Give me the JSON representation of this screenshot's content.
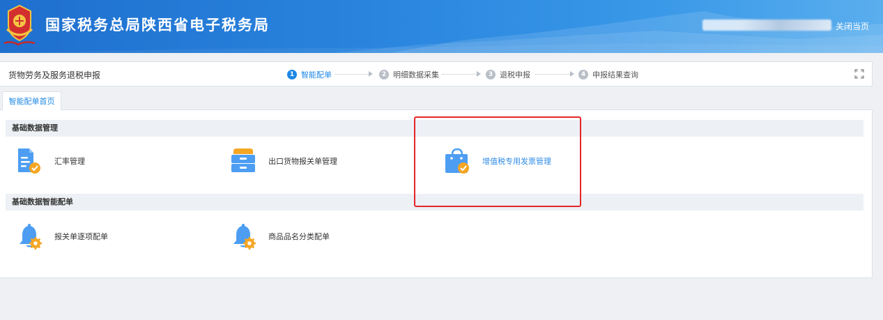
{
  "header": {
    "site_title": "国家税务总局陕西省电子税务局",
    "close_label": "关闭当页",
    "user_info": ""
  },
  "stepbar": {
    "module_title": "货物劳务及服务退税申报",
    "steps": [
      {
        "num": "1",
        "label": "智能配单",
        "active": true
      },
      {
        "num": "2",
        "label": "明细数据采集",
        "active": false
      },
      {
        "num": "3",
        "label": "退税申报",
        "active": false
      },
      {
        "num": "4",
        "label": "申报结果查询",
        "active": false
      }
    ]
  },
  "tab": {
    "label": "智能配单首页"
  },
  "sections": [
    {
      "title": "基础数据管理",
      "items": [
        {
          "label": "汇率管理",
          "icon": "document-check-icon"
        },
        {
          "label": "出口货物报关单管理",
          "icon": "drawer-cabinet-icon"
        },
        {
          "label": "增值税专用发票管理",
          "icon": "shopping-bag-check-icon"
        }
      ]
    },
    {
      "title": "基础数据智能配单",
      "items": [
        {
          "label": "报关单逐项配单",
          "icon": "bell-gear-icon"
        },
        {
          "label": "商品品名分类配单",
          "icon": "bell-gear-icon"
        }
      ]
    }
  ],
  "colors": {
    "header_blue": "#2a86df",
    "accent": "#1e88e5",
    "highlight_border": "#e3262a",
    "icon_blue": "#4d9ef2",
    "icon_orange": "#f5a623"
  }
}
